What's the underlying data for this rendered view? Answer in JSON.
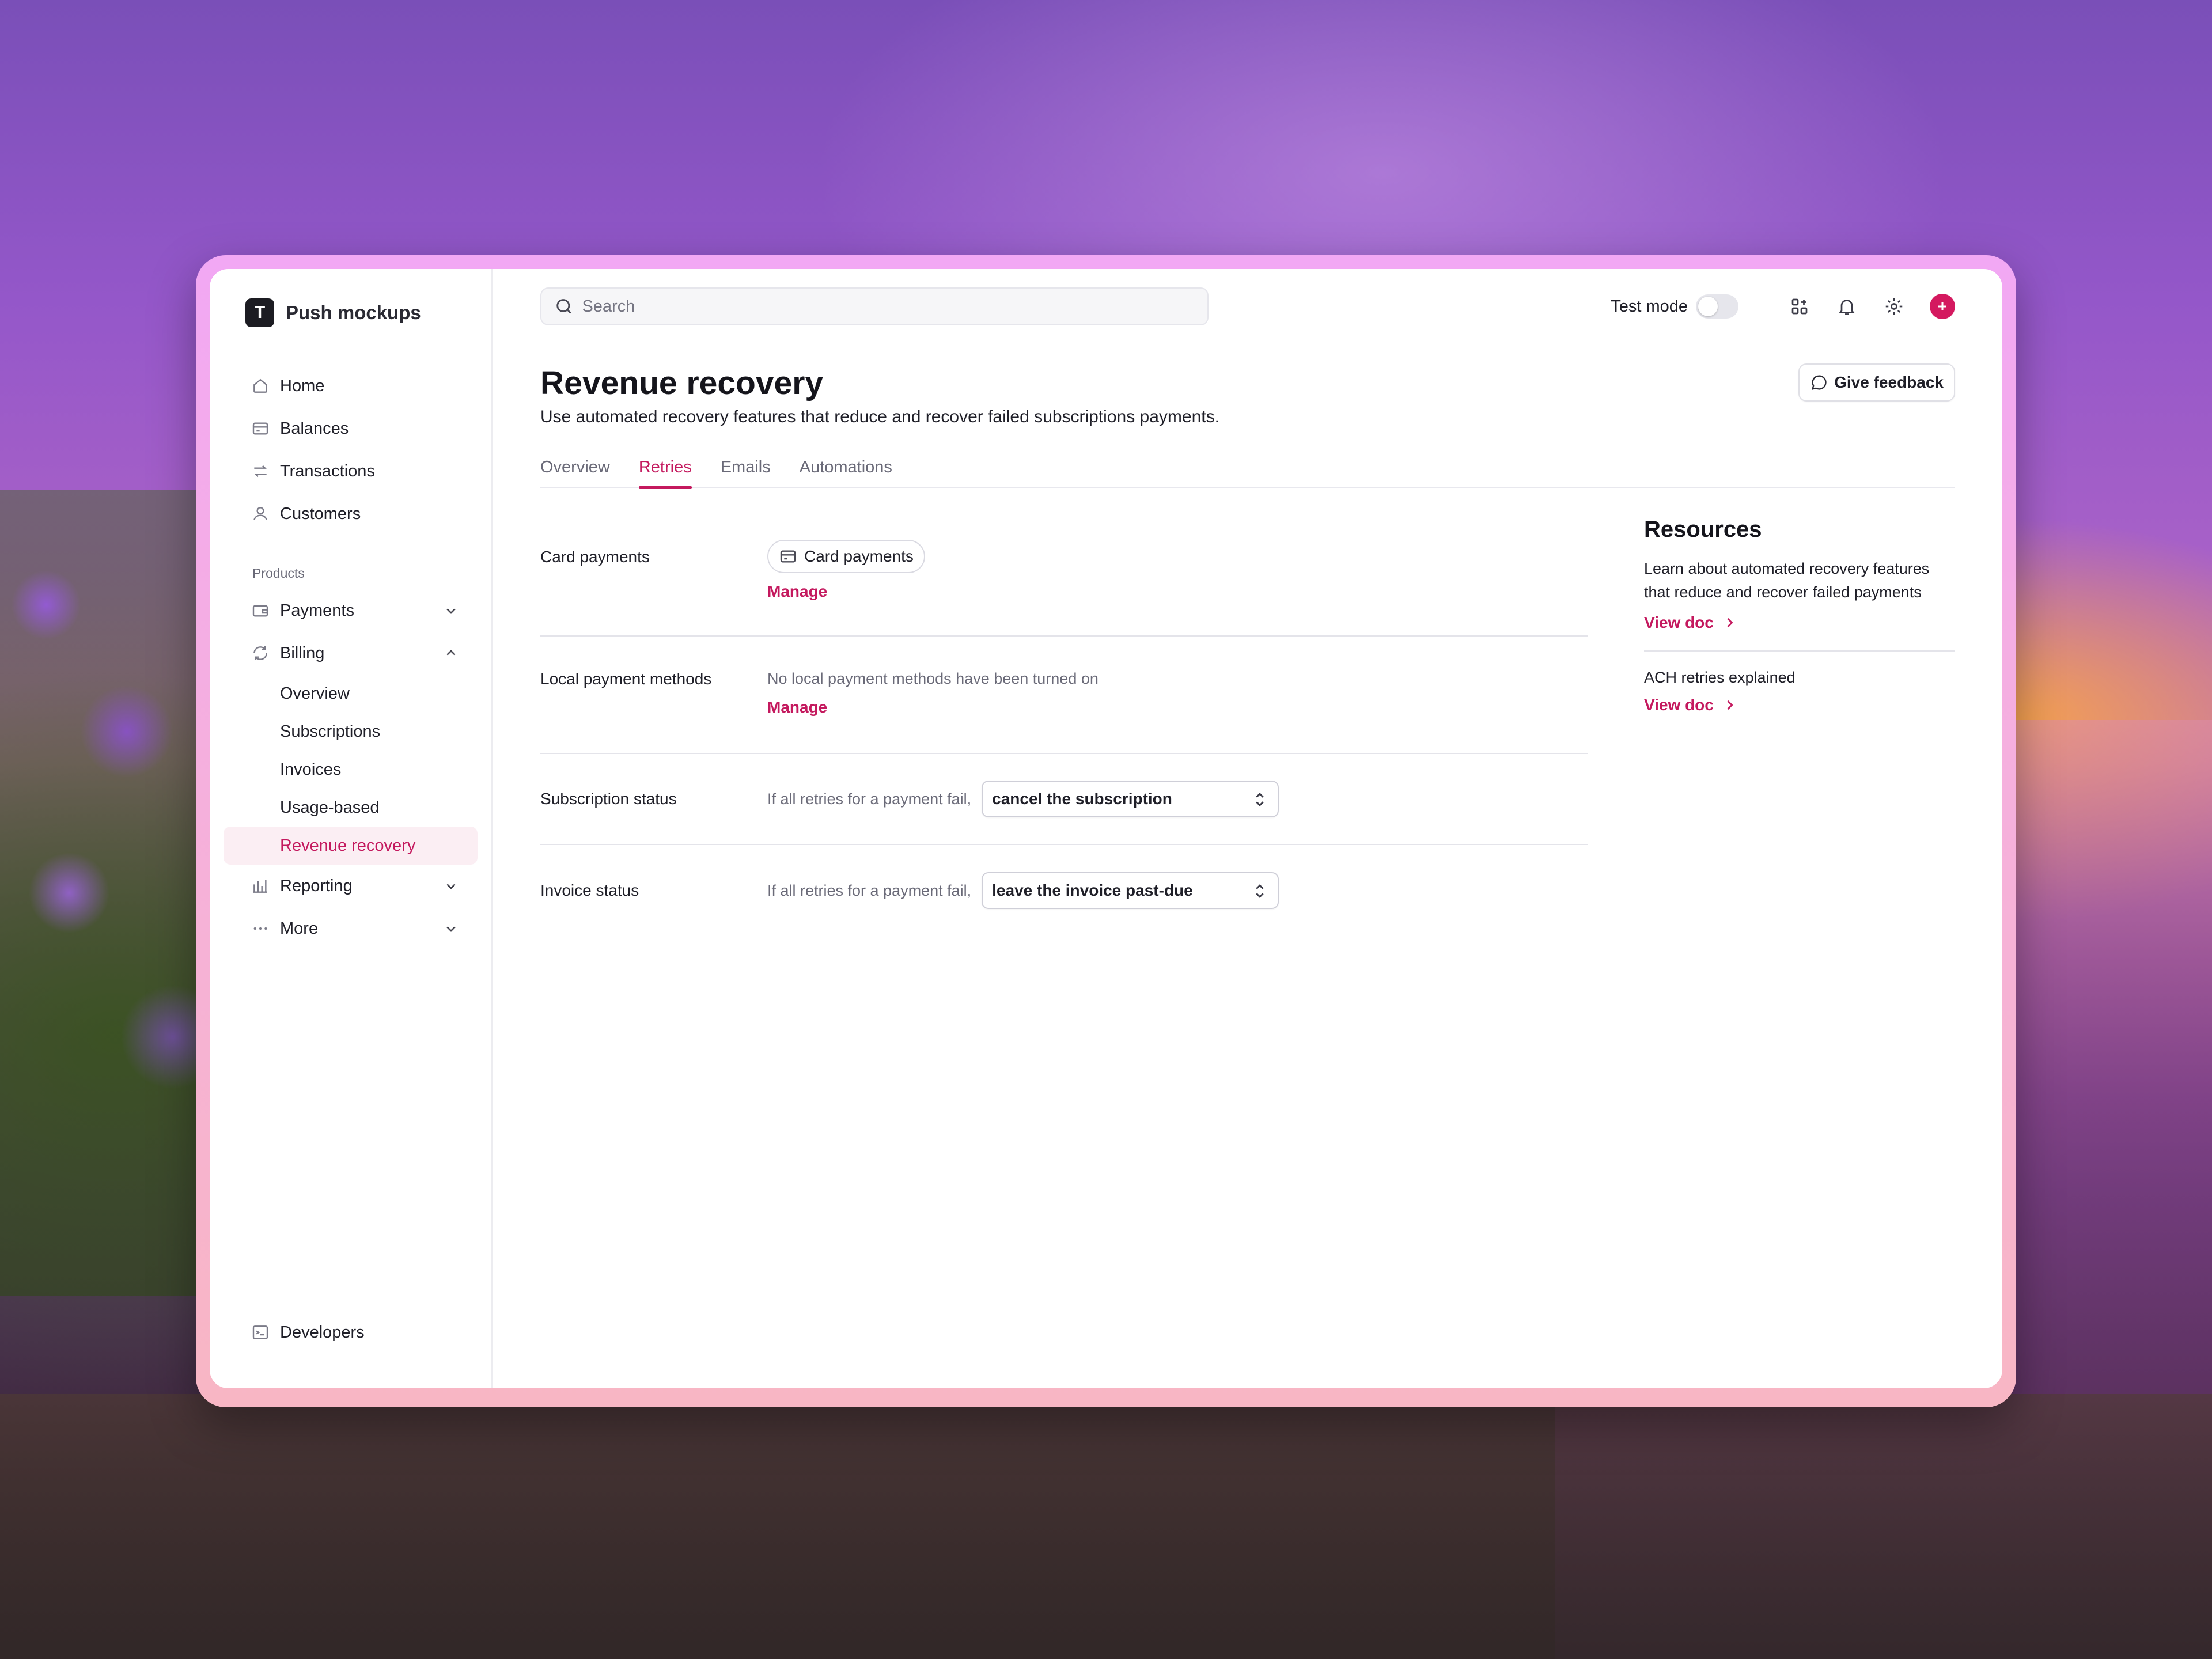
{
  "brand": {
    "logo_letter": "T",
    "name": "Push mockups"
  },
  "sidebar": {
    "items": [
      {
        "label": "Home",
        "icon": "home-icon"
      },
      {
        "label": "Balances",
        "icon": "balances-icon"
      },
      {
        "label": "Transactions",
        "icon": "transactions-icon"
      },
      {
        "label": "Customers",
        "icon": "customers-icon"
      }
    ],
    "section_label": "Products",
    "payments": {
      "label": "Payments",
      "icon": "wallet-icon",
      "expanded": false
    },
    "billing": {
      "label": "Billing",
      "icon": "billing-icon",
      "expanded": true,
      "children": [
        "Overview",
        "Subscriptions",
        "Invoices",
        "Usage-based",
        "Revenue recovery"
      ],
      "active": "Revenue recovery"
    },
    "reporting": {
      "label": "Reporting",
      "icon": "bar-chart-icon",
      "expanded": false
    },
    "more": {
      "label": "More",
      "icon": "dots-icon",
      "expanded": false
    },
    "footer": {
      "label": "Developers",
      "icon": "terminal-icon"
    }
  },
  "topbar": {
    "search_placeholder": "Search",
    "test_mode_label": "Test mode",
    "test_mode_on": false,
    "icons": [
      "apps-icon",
      "bell-icon",
      "gear-icon",
      "plus-circle-icon"
    ]
  },
  "page": {
    "title": "Revenue recovery",
    "subtitle": "Use automated recovery features that reduce and recover failed subscriptions payments.",
    "feedback_label": "Give feedback",
    "tabs": [
      "Overview",
      "Retries",
      "Emails",
      "Automations"
    ],
    "active_tab": "Retries"
  },
  "settings": {
    "card_payments": {
      "label": "Card payments",
      "chip": "Card payments",
      "link": "Manage"
    },
    "local_methods": {
      "label": "Local payment methods",
      "text": "No local payment methods have been turned on",
      "link": "Manage"
    },
    "subscription_status": {
      "label": "Subscription status",
      "prefix": "If all retries for a payment fail,",
      "value": "cancel the subscription"
    },
    "invoice_status": {
      "label": "Invoice status",
      "prefix": "If all retries for a payment fail,",
      "value": "leave the invoice past-due"
    }
  },
  "resources": {
    "title": "Resources",
    "items": [
      {
        "text": "Learn about automated recovery features that reduce and recover failed payments",
        "link": "View doc"
      },
      {
        "text": "ACH retries explained",
        "link": "View doc"
      }
    ]
  },
  "colors": {
    "accent": "#c4195e",
    "plus_button": "#d4195f",
    "frame": "#f2a8f4"
  }
}
